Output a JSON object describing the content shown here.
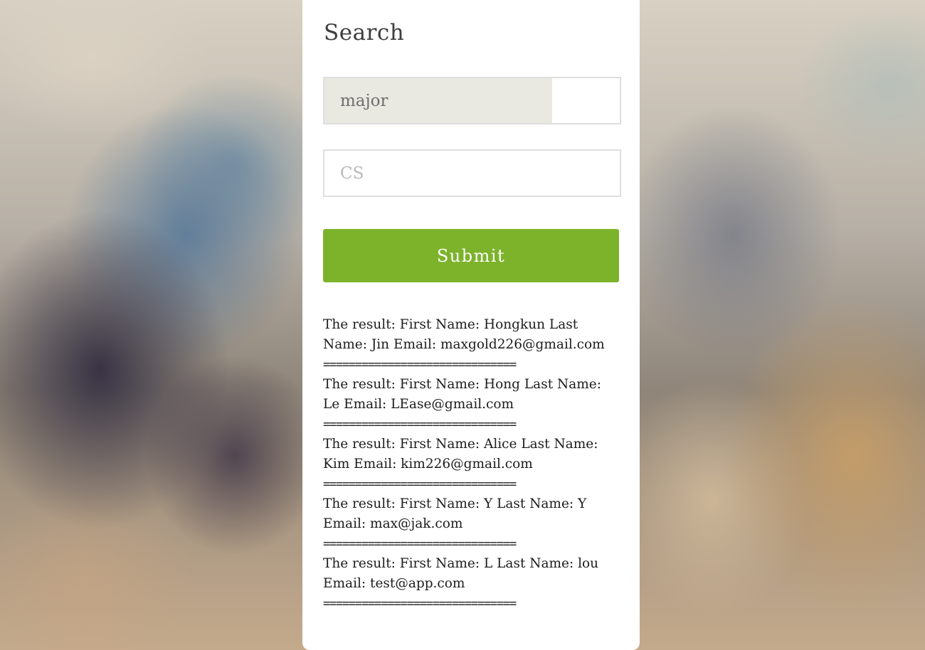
{
  "search": {
    "title": "Search",
    "major_field": {
      "value": "major",
      "placeholder": ""
    },
    "cs_field": {
      "value": "",
      "placeholder": "CS"
    },
    "submit_label": "Submit"
  },
  "results": [
    {
      "text": "The result: First Name: Hongkun Last Name: Jin Email: maxgold226@gmail.com",
      "separator": "=============================="
    },
    {
      "text": "The result: First Name: Hong Last Name: Le Email: LEase@gmail.com",
      "separator": "=============================="
    },
    {
      "text": "The result: First Name: Alice Last Name: Kim Email: kim226@gmail.com",
      "separator": "=============================="
    },
    {
      "text": "The result: First Name: Y Last Name: Y Email: max@jak.com",
      "separator": "=============================="
    },
    {
      "text": "The result: First Name: L Last Name: lou Email: test@app.com",
      "separator": "=============================="
    }
  ],
  "colors": {
    "submit_bg": "#7cb32b",
    "panel_bg": "#ffffff",
    "filled_field_bg": "#e9e9e2"
  }
}
